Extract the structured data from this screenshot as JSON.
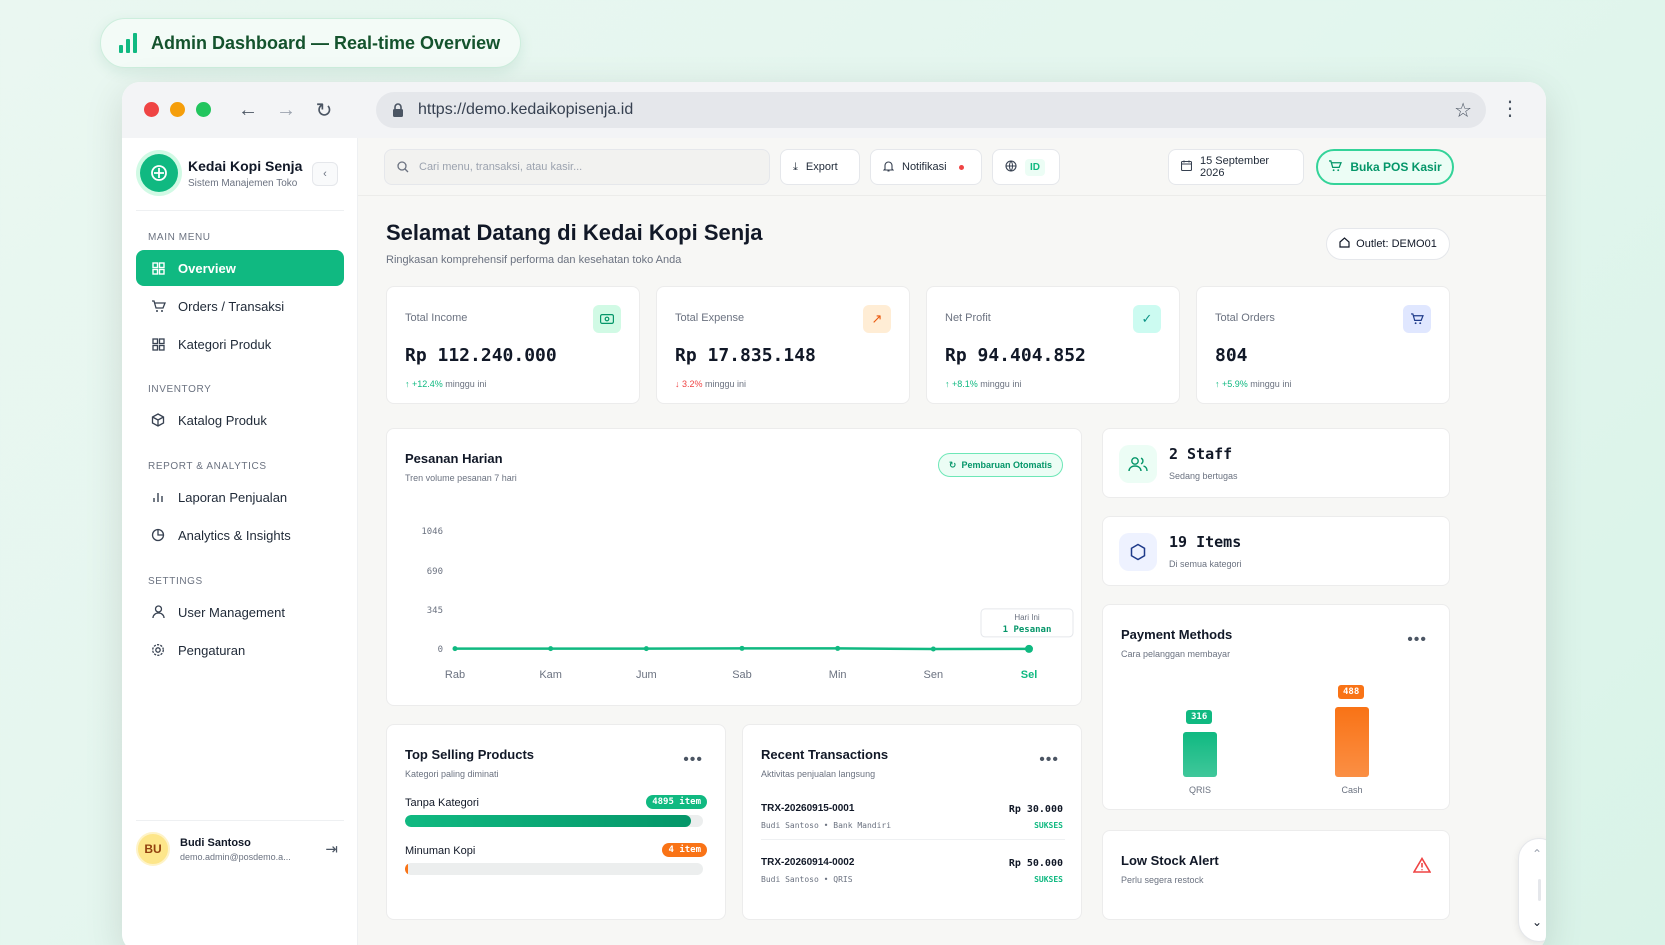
{
  "badge": {
    "title": "Admin Dashboard — Real-time Overview",
    "icon": "bar-chart-icon"
  },
  "browser": {
    "url": "https://demo.kedaikopisenja.id"
  },
  "sidebar": {
    "brand_name": "Kedai Kopi Senja",
    "brand_sub": "Sistem Manajemen Toko",
    "sections": {
      "main_menu": "MAIN MENU",
      "inventory": "INVENTORY",
      "report": "REPORT & ANALYTICS",
      "settings": "SETTINGS"
    },
    "items": [
      {
        "label": "Overview",
        "icon": "grid-icon"
      },
      {
        "label": "Orders / Transaksi",
        "icon": "cart-icon"
      },
      {
        "label": "Kategori Produk",
        "icon": "grid-icon"
      },
      {
        "label": "Katalog Produk",
        "icon": "box-icon"
      },
      {
        "label": "Laporan Penjualan",
        "icon": "bar-chart-icon"
      },
      {
        "label": "Analytics & Insights",
        "icon": "pie-chart-icon"
      },
      {
        "label": "User Management",
        "icon": "user-icon"
      },
      {
        "label": "Pengaturan",
        "icon": "gear-icon"
      }
    ],
    "user": {
      "initials": "BU",
      "name": "Budi Santoso",
      "email": "demo.admin@posdemo.a..."
    }
  },
  "topbar": {
    "search_placeholder": "Cari menu, transaksi, atau kasir...",
    "export": "Export",
    "notifications": "Notifikasi",
    "language": "ID",
    "date": "15 September 2026",
    "pos_button": "Buka POS Kasir"
  },
  "header": {
    "title": "Selamat Datang di Kedai Kopi Senja",
    "subtitle": "Ringkasan komprehensif performa dan kesehatan toko Anda",
    "outlet": "Outlet: DEMO01"
  },
  "stats": [
    {
      "label": "Total Income",
      "value": "Rp 112.240.000",
      "delta": "↑ +12.4%",
      "delta_suffix": "minggu ini",
      "icon": "cash-icon"
    },
    {
      "label": "Total Expense",
      "value": "Rp 17.835.148",
      "delta": "↓ 3.2%",
      "delta_suffix": "minggu ini",
      "icon": "arrow-up-right-icon"
    },
    {
      "label": "Net Profit",
      "value": "Rp 94.404.852",
      "delta": "↑ +8.1%",
      "delta_suffix": "minggu ini",
      "icon": "check-icon"
    },
    {
      "label": "Total Orders",
      "value": "804",
      "delta": "↑ +5.9%",
      "delta_suffix": "minggu ini",
      "icon": "cart-icon"
    }
  ],
  "orders_chart": {
    "title": "Pesanan Harian",
    "subtitle": "Tren volume pesanan 7 hari",
    "auto_button": "Pembaruan Otomatis",
    "tooltip_label": "Hari Ini",
    "tooltip_value": "1  Pesanan"
  },
  "chart_data": {
    "type": "line",
    "categories": [
      "Rab",
      "Kam",
      "Jum",
      "Sab",
      "Min",
      "Sen",
      "Sel"
    ],
    "values": [
      3,
      3,
      3,
      6,
      5,
      0,
      1
    ],
    "yticks": [
      "1046",
      "690",
      "345",
      "0"
    ],
    "ylim": [
      0,
      1046
    ],
    "highlight": "Sel",
    "color": "#10b981"
  },
  "staff": {
    "value": "2 Staff",
    "sub": "Sedang bertugas",
    "icon": "users-icon"
  },
  "items_card": {
    "value": "19 Items",
    "sub": "Di semua kategori",
    "icon": "hexagon-icon"
  },
  "payment": {
    "title": "Payment Methods",
    "subtitle": "Cara pelanggan membayar",
    "bars": [
      {
        "label": "QRIS",
        "value": 316,
        "display": "316",
        "color": "#10b981"
      },
      {
        "label": "Cash",
        "value": 488,
        "display": "488",
        "color": "#f97316"
      }
    ]
  },
  "top_products": {
    "title": "Top Selling Products",
    "subtitle": "Kategori paling diminati",
    "items": [
      {
        "name": "Tanpa Kategori",
        "badge": "4895 item",
        "fraction": 0.96,
        "color": "#10b981"
      },
      {
        "name": "Minuman Kopi",
        "badge": "4 item",
        "fraction": 0.01,
        "color": "#f97316"
      }
    ]
  },
  "transactions": {
    "title": "Recent Transactions",
    "subtitle": "Aktivitas penjualan langsung",
    "rows": [
      {
        "id": "TRX-20260915-0001",
        "meta": "Budi Santoso • Bank Mandiri",
        "amount": "Rp 30.000",
        "status": "SUKSES"
      },
      {
        "id": "TRX-20260914-0002",
        "meta": "Budi Santoso • QRIS",
        "amount": "Rp 50.000",
        "status": "SUKSES"
      }
    ]
  },
  "low_stock": {
    "title": "Low Stock Alert",
    "subtitle": "Perlu segera restock",
    "icon": "warning-icon"
  },
  "colors": {
    "accent": "#10b981",
    "orange": "#f97316",
    "danger": "#ef4444"
  }
}
